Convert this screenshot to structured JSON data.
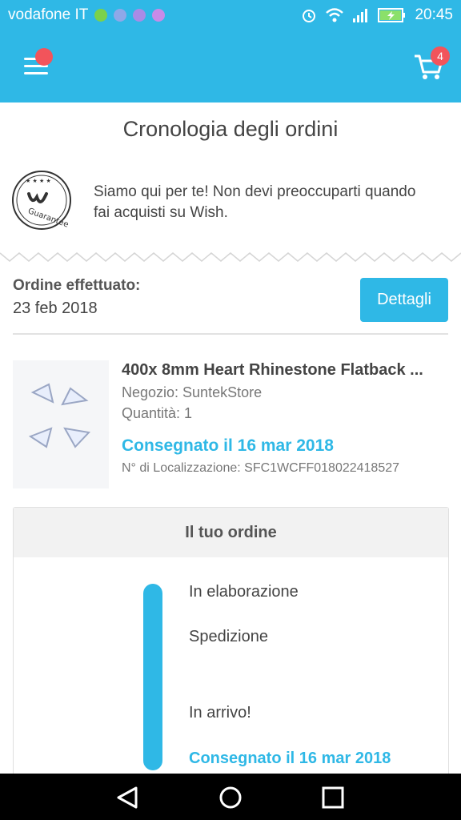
{
  "status_bar": {
    "carrier": "vodafone IT",
    "time": "20:45",
    "icons": [
      "app-notification-icon",
      "facebook-icon",
      "gallery-icon",
      "messenger-icon",
      "alarm-icon",
      "wifi-icon",
      "signal-icon",
      "battery-charging-icon"
    ]
  },
  "app_bar": {
    "menu_icon": "hamburger-menu-icon",
    "cart_icon": "shopping-cart-icon",
    "cart_count": "4",
    "accent_color": "#2fb8e6",
    "badge_color": "#f2545b"
  },
  "page": {
    "title": "Cronologia degli ordini"
  },
  "guarantee": {
    "logo_icon": "wish-guarantee-seal-icon",
    "logo_text": "Guarantee",
    "message": "Siamo qui per te! Non devi preoccuparti quando fai acquisti su Wish."
  },
  "order": {
    "label": "Ordine effettuato:",
    "date": "23 feb 2018",
    "details_button": "Dettagli"
  },
  "product": {
    "image_icon": "heart-rhinestones-image",
    "title": "400x 8mm Heart Rhinestone Flatback ...",
    "store": "Negozio: SuntekStore",
    "quantity": "Quantità: 1",
    "delivery_status": "Consegnato il 16 mar 2018",
    "tracking": "N° di Localizzazione: SFC1WCFF018022418527"
  },
  "order_card": {
    "title": "Il tuo ordine",
    "progress_fraction": 1.0,
    "steps": [
      {
        "label": "In elaborazione"
      },
      {
        "label": "Spedizione"
      },
      {
        "label": "In arrivo!"
      },
      {
        "label": "Consegnato il 16 mar 2018"
      }
    ]
  },
  "nav_bar": {
    "back_icon": "back-triangle-icon",
    "home_icon": "home-circle-icon",
    "recents_icon": "recents-square-icon"
  }
}
